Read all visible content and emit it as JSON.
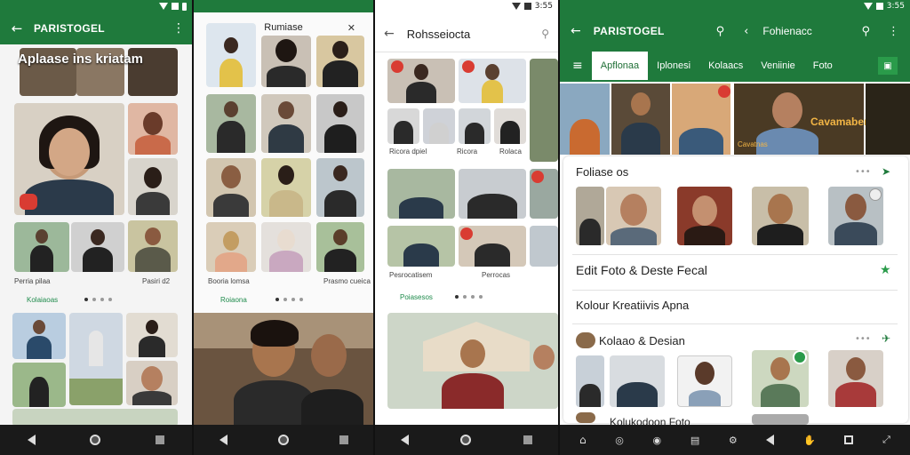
{
  "colors": {
    "primary_green": "#1f7a3c",
    "accent_green": "#2a9b4a",
    "badge_red": "#d93c32",
    "navbar": "#1a1a1a"
  },
  "status": {
    "time": "3:55"
  },
  "screen1": {
    "app_title": "PARISTOGEL",
    "overlay_title": "Aplaase ins kriatam",
    "caption_left": "Perria pilaa",
    "caption_right": "Pasiri d2",
    "link": "Kolaiaoas"
  },
  "screen2": {
    "title": "Rumiase",
    "caption_left": "Booria lomsa",
    "caption_right": "Prasmo cueica",
    "link": "Roiaona"
  },
  "screen3": {
    "title": "Rohsseiocta",
    "caption_row1": [
      "Ricora dpiel",
      "Ricora",
      "Rolaca"
    ],
    "caption_row2": [
      "Pesrocatisem",
      "Perrocas"
    ],
    "link": "Poiasesos"
  },
  "screen4": {
    "app_title": "PARISTOGEL",
    "search_title": "Fohienacc",
    "tabs": [
      "Apflonaa",
      "Iplonesi",
      "Kolaacs",
      "Veniinie",
      "Foto"
    ],
    "banner_text": "Cavamaber",
    "banner_small": "Cavatnas",
    "section1_title": "Foliase os",
    "row_edit": "Edit Foto & Deste Fecal",
    "row_kolour": "Kolour Kreatiivis Apna",
    "section2_title": "Kolaao & Desian",
    "card_title": "Kolukodoon Foto"
  }
}
